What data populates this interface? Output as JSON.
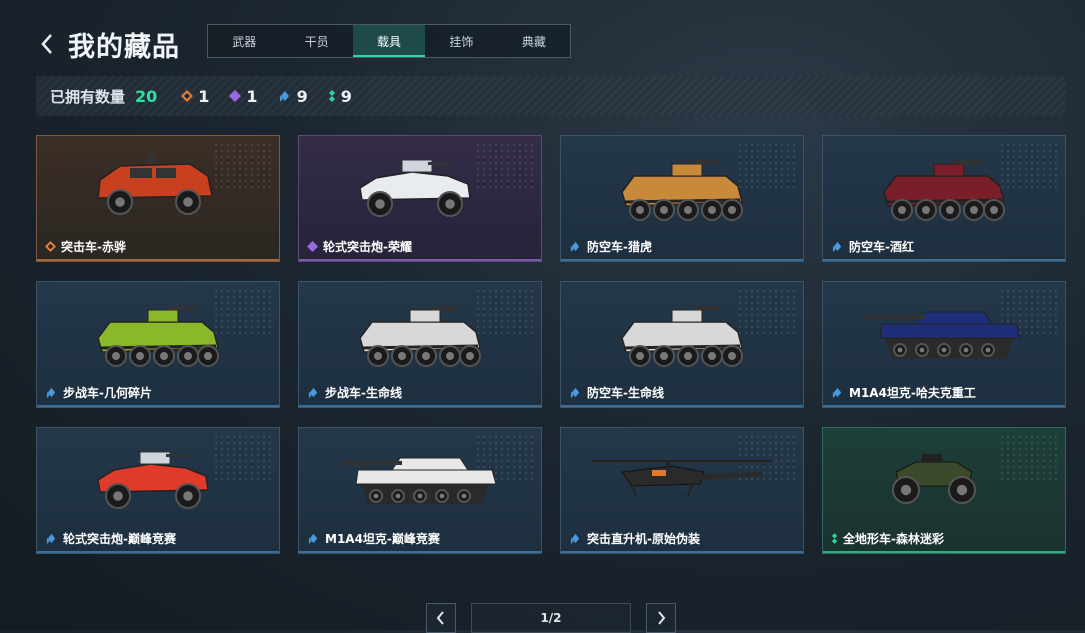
{
  "header": {
    "title": "我的藏品"
  },
  "tabs": [
    {
      "label": "武器",
      "active": false
    },
    {
      "label": "干员",
      "active": false
    },
    {
      "label": "载具",
      "active": true
    },
    {
      "label": "挂饰",
      "active": false
    },
    {
      "label": "典藏",
      "active": false
    }
  ],
  "stats": {
    "label": "已拥有数量",
    "total": "20",
    "rarities": [
      {
        "icon": "orange-rarity-icon",
        "color": "#e0803a",
        "count": "1"
      },
      {
        "icon": "purple-rarity-icon",
        "color": "#9a6ae0",
        "count": "1"
      },
      {
        "icon": "blue-rarity-icon",
        "color": "#4a9ae0",
        "count": "9"
      },
      {
        "icon": "green-rarity-icon",
        "color": "#2fd6a2",
        "count": "9"
      }
    ]
  },
  "items": [
    {
      "name": "突击车-赤骅",
      "rarity": "orange",
      "vehicle": "suv",
      "color": "#c8401e"
    },
    {
      "name": "轮式突击炮-荣耀",
      "rarity": "purple",
      "vehicle": "buggy",
      "color": "#e8ecf0"
    },
    {
      "name": "防空车-猎虎",
      "rarity": "blue",
      "vehicle": "apc",
      "color": "#c88a3a"
    },
    {
      "name": "防空车-酒红",
      "rarity": "blue",
      "vehicle": "apc",
      "color": "#7a1e2a"
    },
    {
      "name": "步战车-几何碎片",
      "rarity": "blue",
      "vehicle": "apc",
      "color": "#8ab82a"
    },
    {
      "name": "步战车-生命线",
      "rarity": "blue",
      "vehicle": "apc",
      "color": "#d8d8d8"
    },
    {
      "name": "防空车-生命线",
      "rarity": "blue",
      "vehicle": "apc",
      "color": "#d8d8d8"
    },
    {
      "name": "M1A4坦克-哈夫克重工",
      "rarity": "blue",
      "vehicle": "tank",
      "color": "#1e2e7a"
    },
    {
      "name": "轮式突击炮-巅峰竞赛",
      "rarity": "blue",
      "vehicle": "buggy",
      "color": "#e03a2a"
    },
    {
      "name": "M1A4坦克-巅峰竞赛",
      "rarity": "blue",
      "vehicle": "tank",
      "color": "#e8e8e8"
    },
    {
      "name": "突击直升机-原始伪装",
      "rarity": "blue",
      "vehicle": "heli",
      "color": "#2a2a2a"
    },
    {
      "name": "全地形车-森林迷彩",
      "rarity": "green",
      "vehicle": "atv",
      "color": "#3a4a2a"
    }
  ],
  "pagination": {
    "page": "1/2"
  }
}
